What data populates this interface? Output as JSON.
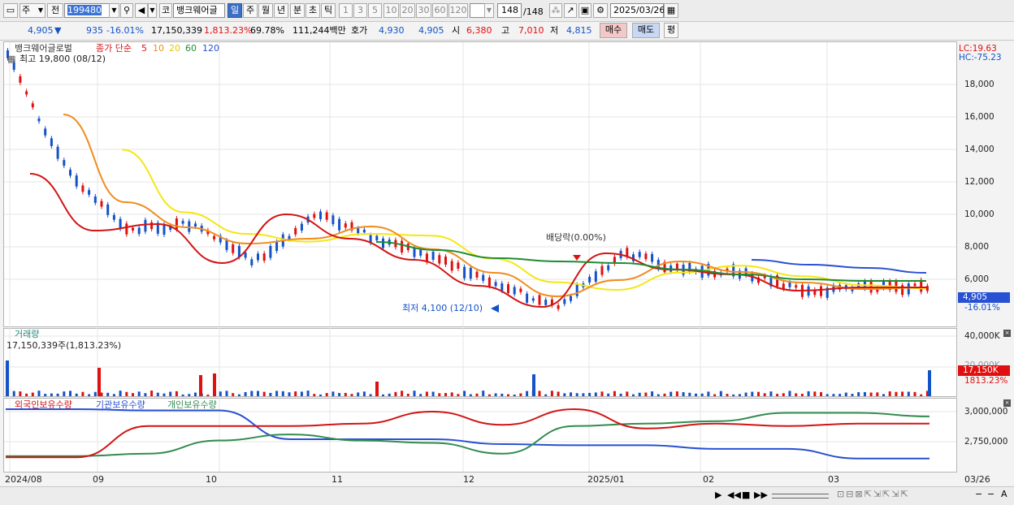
{
  "toolbar": {
    "market_code": "주",
    "prev_label": "전",
    "stock_code": "199480",
    "kospi_label": "코",
    "stock_name": "뱅크웨어글",
    "period_tabs": [
      "일",
      "주",
      "월",
      "년",
      "분",
      "초",
      "틱"
    ],
    "active_period": "일",
    "intervals": [
      "1",
      "3",
      "5",
      "10",
      "20",
      "30",
      "60",
      "120"
    ],
    "count": "148",
    "count_total": "/148",
    "date": "2025/03/26"
  },
  "quote": {
    "price": "4,905",
    "arrow": "▼",
    "change": "935",
    "change_pct": "-16.01%",
    "volume": "17,150,339",
    "volume_pct": "1,813.23%",
    "turnover": "69.78%",
    "amount": "111,244백만",
    "bid_label": "호가",
    "bid": "4,930",
    "ask": "4,905",
    "open_label": "시",
    "open": "6,380",
    "high_label": "고",
    "high": "7,010",
    "low_label": "저",
    "low": "4,815",
    "buy_button": "매수",
    "sell_button": "매도",
    "avg_button": "평"
  },
  "price_panel": {
    "stock_label": "뱅크웨어글로벌",
    "ma_label": "종가 단순",
    "ma_periods": [
      "5",
      "10",
      "20",
      "60",
      "120"
    ],
    "high_note": "최고 19,800 (08/12)",
    "low_note": "최저 4,100 (12/10)",
    "dividend_note": "배당락(0.00%)",
    "lc": "LC:19.63",
    "hc": "HC:-75.23",
    "y_ticks": [
      "18,000",
      "16,000",
      "14,000",
      "12,000",
      "10,000",
      "8,000",
      "6,000"
    ],
    "current_price_tag": "4,905",
    "current_pct_tag": "-16.01%"
  },
  "volume_panel": {
    "title": "거래량",
    "value_note": "17,150,339주(1,813.23%)",
    "y_ticks": [
      "40,000K",
      "20,000K"
    ],
    "current_tag": "17,150K",
    "current_pct": "1813.23%"
  },
  "holdings_panel": {
    "series_labels": [
      "외국인보유수량",
      "기관보유수량",
      "개인보유수량"
    ],
    "y_ticks": [
      "3,000,000",
      "2,750,000"
    ]
  },
  "x_labels": [
    "2024/08",
    "09",
    "10",
    "11",
    "12",
    "2025/01",
    "02",
    "03",
    "03/26"
  ],
  "colors": {
    "up": "#e01010",
    "down": "#1452c8",
    "ma5": "#d21414",
    "ma10": "#f08c1e",
    "ma20": "#f5e614",
    "ma60": "#1e8c32",
    "ma120": "#2850d2",
    "foreign": "#d21414",
    "institution": "#2850d2",
    "individual": "#328c50"
  },
  "chart_data": {
    "type": "line",
    "title": "뱅크웨어글로벌",
    "x": [
      "2024/08",
      "09",
      "10",
      "11",
      "12",
      "2025/01",
      "02",
      "03",
      "03/26"
    ],
    "ylim": [
      4000,
      20000
    ],
    "series": [
      {
        "name": "종가 단순 5",
        "values": [
          19800,
          12500,
          9000,
          9400,
          7000,
          10000,
          8500,
          7200,
          5600,
          4300,
          7600,
          6600,
          6300,
          5300,
          5500,
          5500
        ]
      },
      {
        "name": "종가 단순 60",
        "values": [
          8300,
          7800,
          7300,
          7100,
          7000,
          6600,
          6300,
          6000,
          5900,
          5900
        ]
      },
      {
        "name": "종가 단순 120",
        "values": [
          7200,
          6900,
          6700,
          6400
        ]
      }
    ],
    "volume": {
      "ylim": [
        0,
        40000
      ],
      "last": 17150,
      "unit": "K"
    },
    "holdings": {
      "ylim": [
        2600000,
        3100000
      ],
      "series": [
        {
          "name": "외국인보유수량",
          "values": [
            2620000,
            2620000,
            2880000,
            2880000,
            2880000,
            2900000,
            3000000,
            2890000,
            3020000,
            2860000,
            2900000,
            2880000,
            2900000,
            2900000
          ]
        },
        {
          "name": "기관보유수량",
          "values": [
            3020000,
            3020000,
            3010000,
            3010000,
            2770000,
            2770000,
            2770000,
            2730000,
            2720000,
            2720000,
            2690000,
            2690000,
            2610000,
            2610000
          ]
        },
        {
          "name": "개인보유수량",
          "values": [
            2630000,
            2630000,
            2650000,
            2760000,
            2810000,
            2760000,
            2740000,
            2650000,
            2880000,
            2900000,
            2920000,
            2990000,
            2990000,
            2960000
          ]
        }
      ]
    }
  }
}
